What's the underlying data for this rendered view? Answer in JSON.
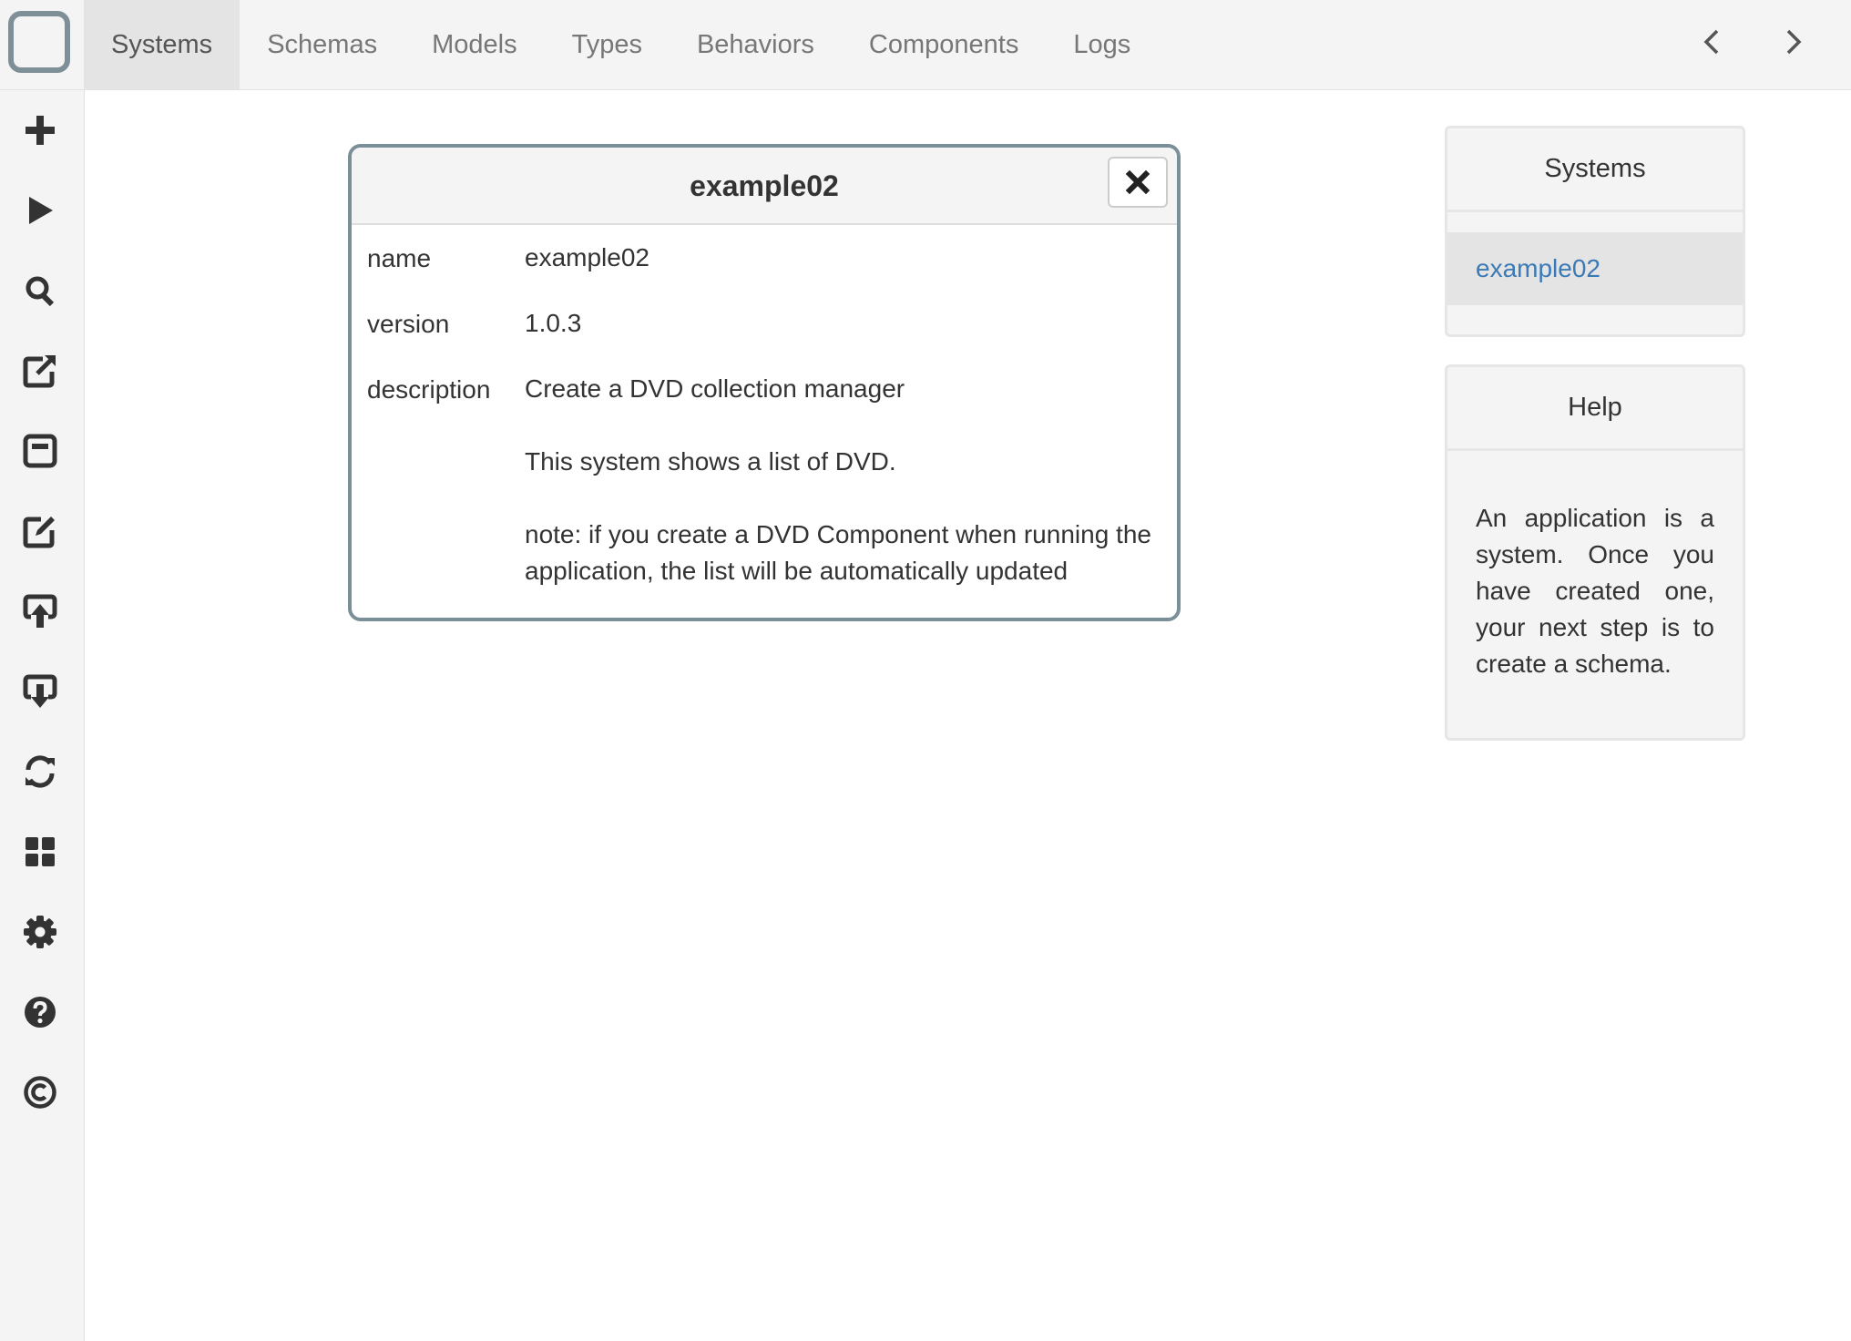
{
  "nav": {
    "tabs": [
      {
        "label": "Systems"
      },
      {
        "label": "Schemas"
      },
      {
        "label": "Models"
      },
      {
        "label": "Types"
      },
      {
        "label": "Behaviors"
      },
      {
        "label": "Components"
      },
      {
        "label": "Logs"
      }
    ],
    "active_tab": "Systems",
    "prev_icon": "chevron-left-icon",
    "next_icon": "chevron-right-icon"
  },
  "sidebar": {
    "icons": [
      "plus-icon",
      "play-icon",
      "search-icon",
      "share-icon",
      "window-icon",
      "edit-icon",
      "upload-icon",
      "download-icon",
      "refresh-icon",
      "dashboard-icon",
      "gear-icon",
      "help-icon",
      "copyright-icon"
    ]
  },
  "dialog": {
    "title": "example02",
    "close_icon": "close-icon",
    "fields": {
      "name_label": "name",
      "name_value": "example02",
      "version_label": "version",
      "version_value": "1.0.3",
      "description_label": "description",
      "description_line1": "Create a DVD collection manager",
      "description_line2": "This system shows a list of DVD.",
      "description_line3": "note: if you create a DVD Component when running the",
      "description_line4": "application, the list will be automatically updated"
    }
  },
  "systems_panel": {
    "title": "Systems",
    "items": [
      {
        "label": "example02"
      }
    ]
  },
  "help_panel": {
    "title": "Help",
    "text": "An application is a system. Once you have created one, your next step is to create a schema."
  },
  "colors": {
    "accent_link": "#3a7ab7",
    "dialog_border": "#7a8f97",
    "icon": "#333333"
  }
}
